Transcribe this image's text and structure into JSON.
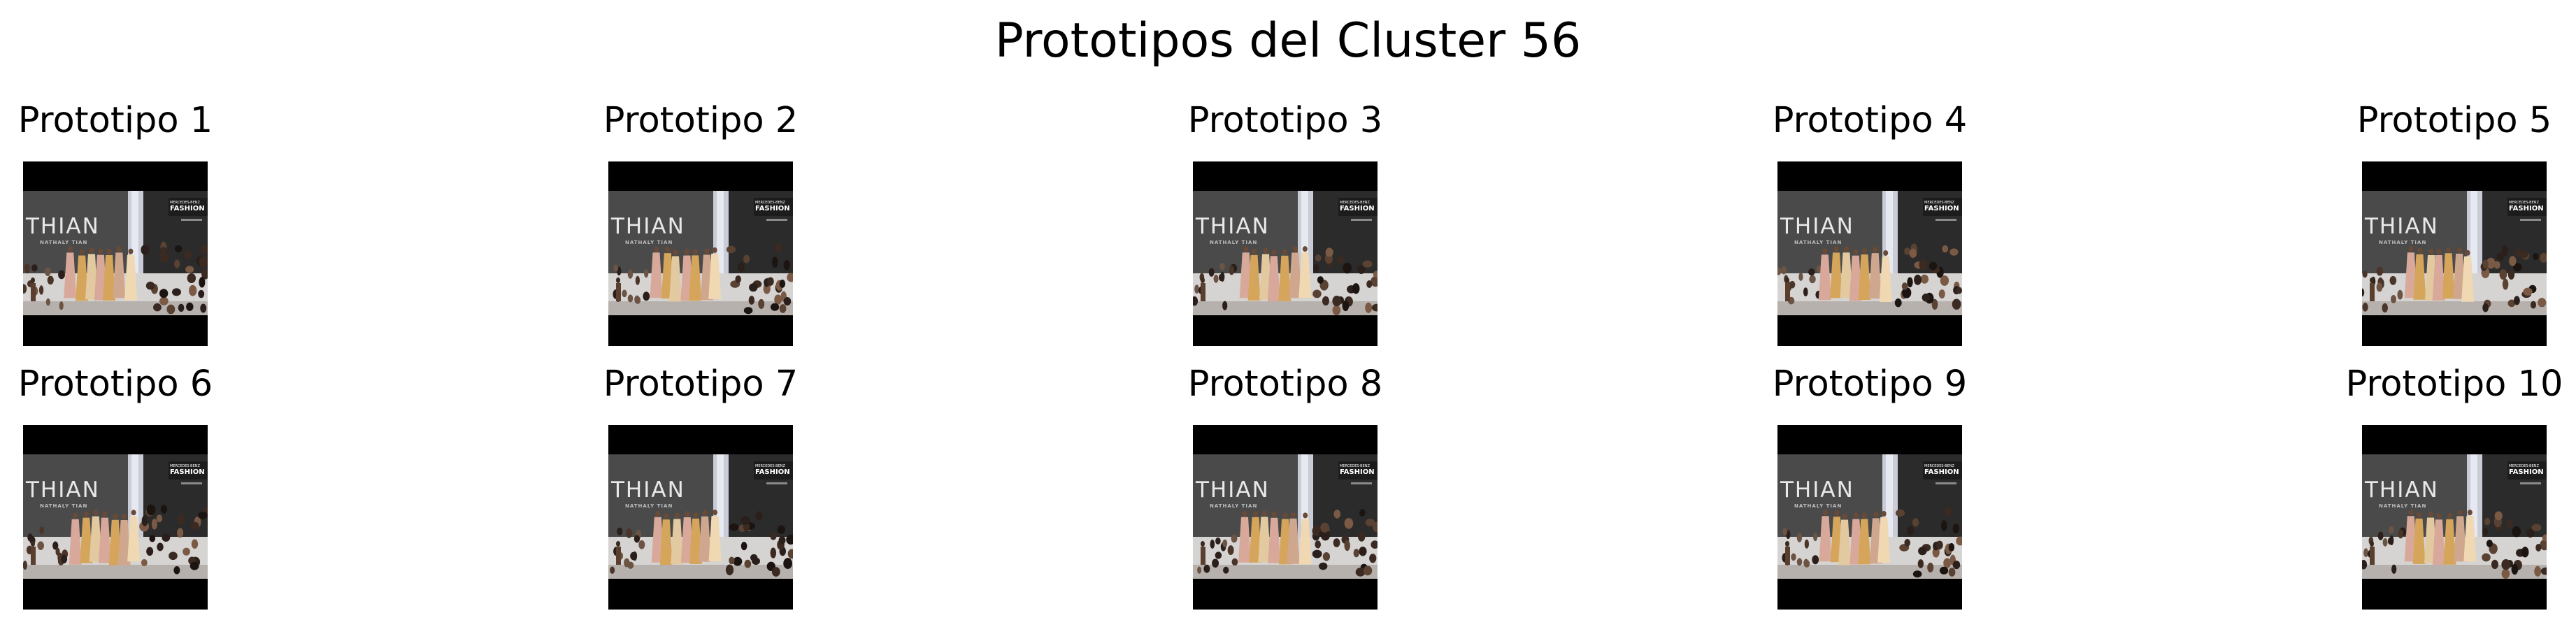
{
  "title": "Prototipos del Cluster 56",
  "prototypes": [
    {
      "label": "Prototipo 1",
      "variant": 0
    },
    {
      "label": "Prototipo 2",
      "variant": 1
    },
    {
      "label": "Prototipo 3",
      "variant": 2
    },
    {
      "label": "Prototipo 4",
      "variant": 1
    },
    {
      "label": "Prototipo 5",
      "variant": 0
    },
    {
      "label": "Prototipo 6",
      "variant": 2
    },
    {
      "label": "Prototipo 7",
      "variant": 1
    },
    {
      "label": "Prototipo 8",
      "variant": 2
    },
    {
      "label": "Prototipo 9",
      "variant": 0
    },
    {
      "label": "Prototipo 10",
      "variant": 1
    }
  ],
  "image_text": {
    "brand": "THIAN",
    "subbrand": "NATHALY TIAN",
    "sign": "FASHION"
  },
  "colors": {
    "background": "#ffffff",
    "frame": "#000000",
    "wall": "#3c3c3c",
    "screen": "#c9cbd6",
    "crowd": "#2a1f1a",
    "gown_gold": "#d4a55a",
    "gown_pink": "#d8a99a"
  }
}
